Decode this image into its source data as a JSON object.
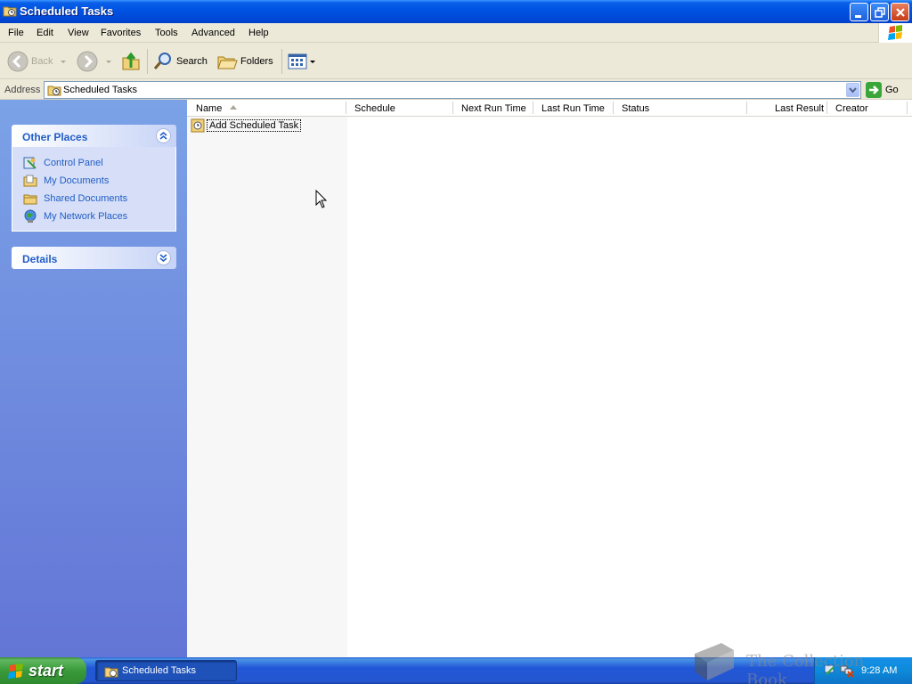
{
  "window": {
    "title": "Scheduled Tasks"
  },
  "menu": {
    "items": [
      "File",
      "Edit",
      "View",
      "Favorites",
      "Tools",
      "Advanced",
      "Help"
    ]
  },
  "toolbar": {
    "back_label": "Back",
    "search_label": "Search",
    "folders_label": "Folders"
  },
  "address": {
    "label": "Address",
    "value": "Scheduled Tasks",
    "go_label": "Go"
  },
  "task_pane": {
    "other_places": {
      "title": "Other Places",
      "links": [
        {
          "label": "Control Panel",
          "icon": "control-panel-icon"
        },
        {
          "label": "My Documents",
          "icon": "my-documents-icon"
        },
        {
          "label": "Shared Documents",
          "icon": "folder-icon"
        },
        {
          "label": "My Network Places",
          "icon": "network-places-icon"
        }
      ]
    },
    "details": {
      "title": "Details"
    }
  },
  "list": {
    "columns": [
      "Name",
      "Schedule",
      "Next Run Time",
      "Last Run Time",
      "Status",
      "Last Result",
      "Creator"
    ],
    "items": [
      {
        "name": "Add Scheduled Task",
        "icon": "add-task-icon"
      }
    ]
  },
  "taskbar": {
    "start_label": "start",
    "task_button_label": "Scheduled Tasks",
    "clock": "9:28 AM"
  },
  "watermark": {
    "text": "The Collection Book"
  },
  "colors": {
    "titlebar": "#0054e3",
    "taskpane_link": "#215dc6",
    "start_green": "#3a9a3a"
  }
}
